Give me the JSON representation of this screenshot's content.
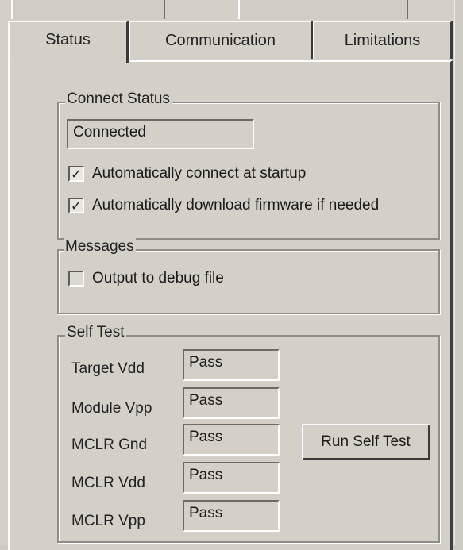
{
  "tabs": [
    {
      "label": "Status",
      "active": true
    },
    {
      "label": "Communication",
      "active": false
    },
    {
      "label": "Limitations",
      "active": false
    }
  ],
  "connect_status": {
    "title": "Connect Status",
    "status_value": "Connected",
    "auto_connect": {
      "label": "Automatically connect at startup",
      "checked": true
    },
    "auto_download": {
      "label": "Automatically download firmware if needed",
      "checked": true
    }
  },
  "messages": {
    "title": "Messages",
    "debug_output": {
      "label": "Output to debug file",
      "checked": false
    }
  },
  "self_test": {
    "title": "Self Test",
    "rows": [
      {
        "label": "Target Vdd",
        "value": "Pass"
      },
      {
        "label": "Module Vpp",
        "value": "Pass"
      },
      {
        "label": "MCLR Gnd",
        "value": "Pass"
      },
      {
        "label": "MCLR Vdd",
        "value": "Pass"
      },
      {
        "label": "MCLR Vpp",
        "value": "Pass"
      }
    ],
    "run_button": "Run Self Test"
  }
}
